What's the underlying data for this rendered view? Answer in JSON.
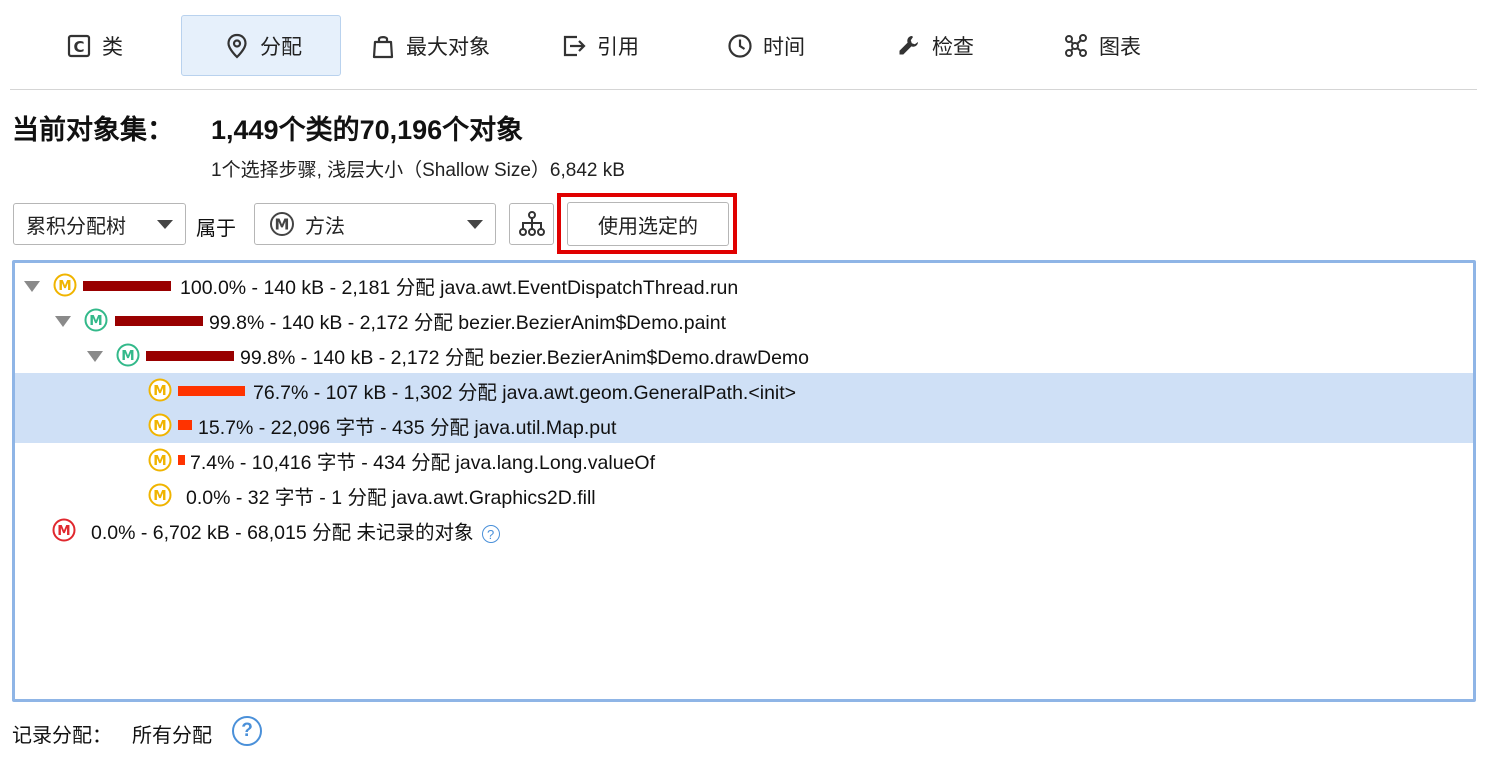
{
  "tabs": [
    {
      "label": "类",
      "icon": "class-c-icon"
    },
    {
      "label": "分配",
      "icon": "location-pin-icon"
    },
    {
      "label": "最大对象",
      "icon": "shopping-bag-icon"
    },
    {
      "label": "引用",
      "icon": "export-arrow-icon"
    },
    {
      "label": "时间",
      "icon": "clock-icon"
    },
    {
      "label": "检查",
      "icon": "wrench-icon"
    },
    {
      "label": "图表",
      "icon": "graph-nodes-icon"
    }
  ],
  "active_tab": "分配",
  "header": {
    "label": "当前对象集：",
    "value": "1,449个类的70,196个对象",
    "sub": "1个选择步骤, 浅层大小（Shallow Size）6,842 kB"
  },
  "toolbar": {
    "view_select": "累积分配树",
    "belongs_label": "属于",
    "method_select": "方法",
    "method_icon_letter": "M",
    "use_selected_button": "使用选定的"
  },
  "tree": {
    "rows": [
      {
        "text": "100.0% - 140 kB - 2,181 分配 java.awt.EventDispatchThread.run",
        "fraction": 1.0,
        "icon_letter": "M"
      },
      {
        "text": "99.8% - 140 kB - 2,172 分配 bezier.BezierAnim$Demo.paint",
        "fraction": 0.998,
        "icon_letter": "M"
      },
      {
        "text": "99.8% - 140 kB - 2,172 分配 bezier.BezierAnim$Demo.drawDemo",
        "fraction": 0.998,
        "icon_letter": "M"
      },
      {
        "text": "76.7% - 107 kB - 1,302 分配 java.awt.geom.GeneralPath.<init>",
        "fraction": 0.767,
        "icon_letter": "M"
      },
      {
        "text": "15.7% - 22,096 字节 - 435 分配 java.util.Map.put",
        "fraction": 0.157,
        "icon_letter": "M"
      },
      {
        "text": "7.4% - 10,416 字节 - 434 分配 java.lang.Long.valueOf",
        "fraction": 0.074,
        "icon_letter": "M"
      },
      {
        "text": "0.0% - 32 字节 - 1 分配 java.awt.Graphics2D.fill",
        "fraction": 0.0,
        "icon_letter": "M"
      },
      {
        "text": "0.0% - 6,702 kB - 68,015 分配 未记录的对象",
        "fraction": 0.0,
        "icon_letter": "M",
        "help": "?"
      }
    ]
  },
  "footer": {
    "label": "记录分配：",
    "value": "所有分配",
    "help": "?"
  },
  "colors": {
    "accent_border": "#8fb5e6",
    "selected_row": "#cfe0f6",
    "highlight_red": "#e00000",
    "bar_dark": "#990000",
    "bar_bright": "#ff3300",
    "icon_yellow": "#f0b400",
    "icon_green": "#33b98a",
    "icon_red": "#e0282e"
  }
}
